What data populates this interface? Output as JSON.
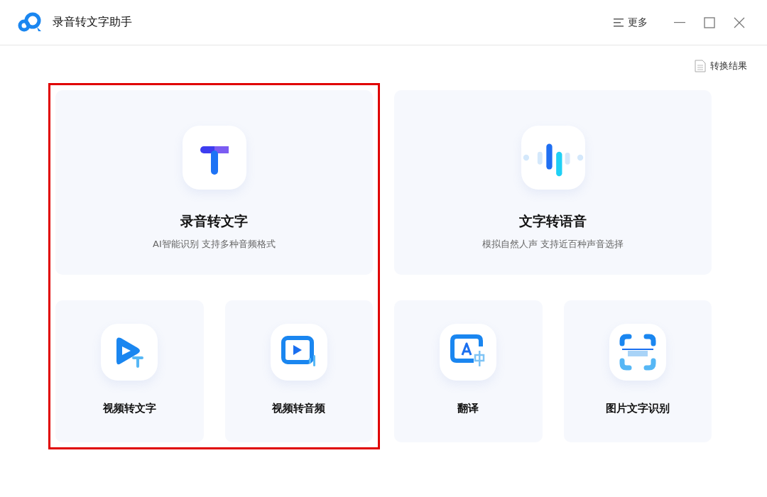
{
  "window": {
    "title": "录音转文字助手",
    "more": "更多"
  },
  "results_link": "转换结果",
  "groups": [
    {
      "highlighted": true,
      "main": {
        "kind": "text",
        "title": "录音转文字",
        "subtitle": "AI智能识别 支持多种音频格式"
      },
      "tools": [
        {
          "kind": "video-text",
          "title": "视频转文字"
        },
        {
          "kind": "video-audio",
          "title": "视频转音频"
        }
      ]
    },
    {
      "highlighted": false,
      "main": {
        "kind": "voice",
        "title": "文字转语音",
        "subtitle": "模拟自然人声 支持近百种声音选择"
      },
      "tools": [
        {
          "kind": "translate",
          "title": "翻译"
        },
        {
          "kind": "scan",
          "title": "图片文字识别"
        }
      ]
    }
  ]
}
